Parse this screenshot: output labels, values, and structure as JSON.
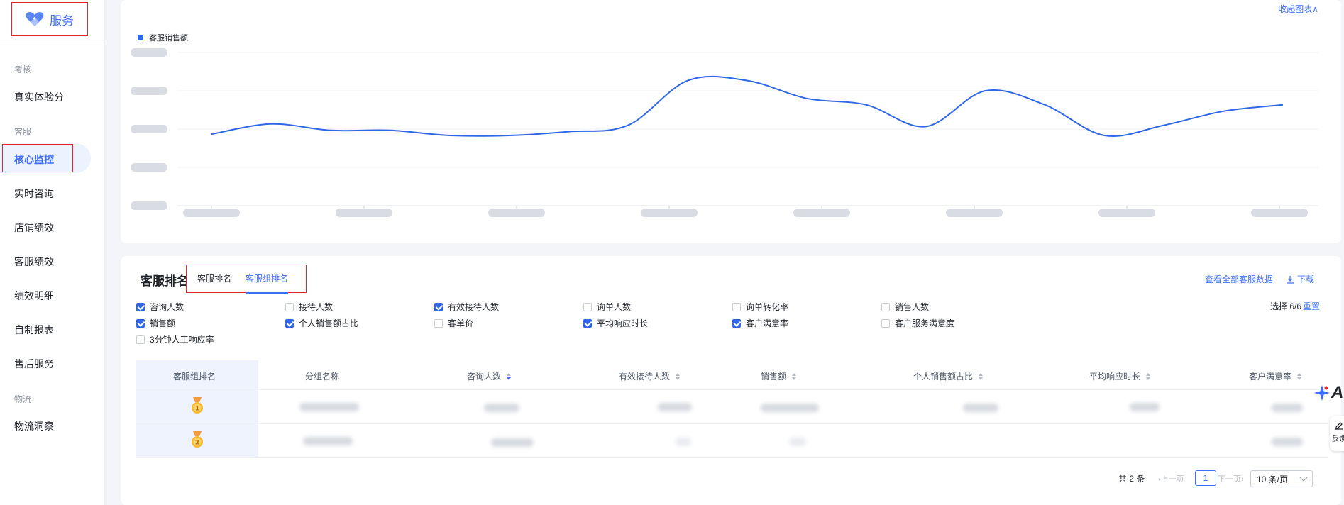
{
  "sidebar": {
    "brand": "服务",
    "groups": [
      {
        "label": "考核",
        "items": [
          "真实体验分"
        ]
      },
      {
        "label": "客服",
        "items": [
          "核心监控",
          "实时咨询",
          "店铺绩效",
          "客服绩效",
          "绩效明细",
          "自制报表",
          "售后服务"
        ]
      },
      {
        "label": "物流",
        "items": [
          "物流洞察"
        ]
      }
    ],
    "active_item": "核心监控"
  },
  "chart_card": {
    "collapse_label": "收起图表∧",
    "legend": "客服销售额"
  },
  "chart_data": {
    "type": "line",
    "series": [
      {
        "name": "客服销售额",
        "values": [
          56,
          64,
          59,
          59,
          55,
          55,
          58,
          63,
          98,
          98,
          84,
          79,
          62,
          90,
          79,
          55,
          63,
          74,
          79
        ]
      }
    ],
    "categories": [],
    "yticks_visible": false,
    "grid": true,
    "color": "#2f67e6"
  },
  "ranking": {
    "title": "客服排名",
    "tabs": [
      "客服排名",
      "客服组排名"
    ],
    "active_tab": "客服组排名",
    "view_all": "查看全部客服数据",
    "download": "下载",
    "metrics": [
      {
        "label": "咨询人数",
        "checked": true
      },
      {
        "label": "接待人数",
        "checked": false
      },
      {
        "label": "有效接待人数",
        "checked": true
      },
      {
        "label": "询单人数",
        "checked": false
      },
      {
        "label": "询单转化率",
        "checked": false
      },
      {
        "label": "销售人数",
        "checked": false
      },
      {
        "label": "销售额",
        "checked": true
      },
      {
        "label": "个人销售额占比",
        "checked": true
      },
      {
        "label": "客单价",
        "checked": false
      },
      {
        "label": "平均响应时长",
        "checked": true
      },
      {
        "label": "客户满意率",
        "checked": true
      },
      {
        "label": "客户服务满意度",
        "checked": false
      },
      {
        "label": "3分钟人工响应率",
        "checked": false
      }
    ],
    "select_prefix": "选择 6/6",
    "reset": "重置",
    "table": {
      "columns": [
        "客服组排名",
        "分组名称",
        "咨询人数",
        "有效接待人数",
        "销售额",
        "个人销售额占比",
        "平均响应时长",
        "客户满意率"
      ],
      "rows": [
        {
          "rank": "1"
        },
        {
          "rank": "2"
        }
      ]
    },
    "pagination": {
      "total": "共 2 条",
      "prev": "上一页",
      "page": "1",
      "next": "下一页",
      "page_size": "10 条/页"
    }
  },
  "floating": {
    "ai_label": "AI",
    "feedback": "反馈"
  }
}
